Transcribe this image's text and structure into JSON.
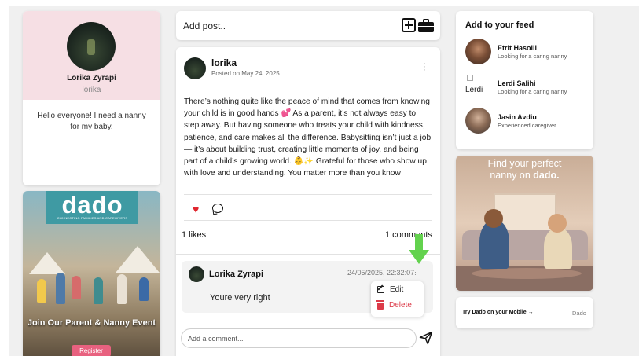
{
  "profile": {
    "name": "Lorika Zyrapi",
    "username": "lorika",
    "bio": "Hello everyone! I need a nanny for my baby."
  },
  "event": {
    "logo": "dado",
    "tagline": "CONNECTING FAMILIES AND CAREGIVERS",
    "title": "Join Our Parent & Nanny Event",
    "register_label": "Register"
  },
  "composer": {
    "label": "Add post..",
    "add_icon": "plus-square-icon",
    "job_icon": "briefcase-icon"
  },
  "post": {
    "author": "lorika",
    "date": "Posted on May 24, 2025",
    "text": "There’s nothing quite like the peace of mind that comes from knowing your child is in good hands 💕 As a parent, it’s not always easy to step away. But having someone who treats your child with kindness, patience, and care makes all the difference. Babysitting isn’t just a job — it’s about building trust, creating little moments of joy, and being part of a child’s growing world. 👶✨ Grateful for those who show up with love and understanding. You matter more than you know",
    "likes": "1 likes",
    "comments_count": "1 comments",
    "comment": {
      "author": "Lorika Zyrapi",
      "timestamp": "24/05/2025, 22:32:07",
      "text": "Youre very right"
    },
    "menu": {
      "edit": "Edit",
      "delete": "Delete"
    },
    "comment_placeholder": "Add a comment..."
  },
  "feed": {
    "title": "Add to your feed",
    "items": [
      {
        "name": "Etrit Hasolli",
        "subtitle": "Looking for a caring nanny"
      },
      {
        "name": "Lerdi Salihi",
        "subtitle": "Looking for a caring nanny",
        "avatar_alt": "Lerdi"
      },
      {
        "name": "Jasin Avdiu",
        "subtitle": "Experienced caregiver"
      }
    ]
  },
  "ad": {
    "line1": "Find your perfect",
    "line2_prefix": "nanny on ",
    "line2_brand": "dado."
  },
  "mobile": {
    "link": "Try Dado on your Mobile →",
    "brand": "Dado"
  },
  "colors": {
    "accent_pink": "#e8617f",
    "like_red": "#e0262f",
    "delete_red": "#dc3b49",
    "arrow_green": "#63d24e",
    "profile_bg": "#f6dfe4"
  }
}
